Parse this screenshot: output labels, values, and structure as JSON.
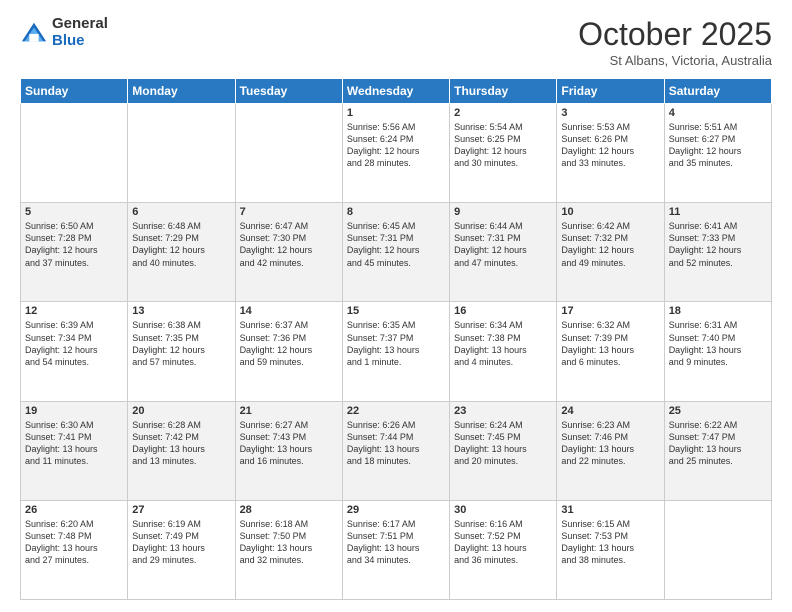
{
  "header": {
    "logo_general": "General",
    "logo_blue": "Blue",
    "month": "October 2025",
    "location": "St Albans, Victoria, Australia"
  },
  "weekdays": [
    "Sunday",
    "Monday",
    "Tuesday",
    "Wednesday",
    "Thursday",
    "Friday",
    "Saturday"
  ],
  "weeks": [
    [
      {
        "day": "",
        "info": ""
      },
      {
        "day": "",
        "info": ""
      },
      {
        "day": "",
        "info": ""
      },
      {
        "day": "1",
        "info": "Sunrise: 5:56 AM\nSunset: 6:24 PM\nDaylight: 12 hours\nand 28 minutes."
      },
      {
        "day": "2",
        "info": "Sunrise: 5:54 AM\nSunset: 6:25 PM\nDaylight: 12 hours\nand 30 minutes."
      },
      {
        "day": "3",
        "info": "Sunrise: 5:53 AM\nSunset: 6:26 PM\nDaylight: 12 hours\nand 33 minutes."
      },
      {
        "day": "4",
        "info": "Sunrise: 5:51 AM\nSunset: 6:27 PM\nDaylight: 12 hours\nand 35 minutes."
      }
    ],
    [
      {
        "day": "5",
        "info": "Sunrise: 6:50 AM\nSunset: 7:28 PM\nDaylight: 12 hours\nand 37 minutes."
      },
      {
        "day": "6",
        "info": "Sunrise: 6:48 AM\nSunset: 7:29 PM\nDaylight: 12 hours\nand 40 minutes."
      },
      {
        "day": "7",
        "info": "Sunrise: 6:47 AM\nSunset: 7:30 PM\nDaylight: 12 hours\nand 42 minutes."
      },
      {
        "day": "8",
        "info": "Sunrise: 6:45 AM\nSunset: 7:31 PM\nDaylight: 12 hours\nand 45 minutes."
      },
      {
        "day": "9",
        "info": "Sunrise: 6:44 AM\nSunset: 7:31 PM\nDaylight: 12 hours\nand 47 minutes."
      },
      {
        "day": "10",
        "info": "Sunrise: 6:42 AM\nSunset: 7:32 PM\nDaylight: 12 hours\nand 49 minutes."
      },
      {
        "day": "11",
        "info": "Sunrise: 6:41 AM\nSunset: 7:33 PM\nDaylight: 12 hours\nand 52 minutes."
      }
    ],
    [
      {
        "day": "12",
        "info": "Sunrise: 6:39 AM\nSunset: 7:34 PM\nDaylight: 12 hours\nand 54 minutes."
      },
      {
        "day": "13",
        "info": "Sunrise: 6:38 AM\nSunset: 7:35 PM\nDaylight: 12 hours\nand 57 minutes."
      },
      {
        "day": "14",
        "info": "Sunrise: 6:37 AM\nSunset: 7:36 PM\nDaylight: 12 hours\nand 59 minutes."
      },
      {
        "day": "15",
        "info": "Sunrise: 6:35 AM\nSunset: 7:37 PM\nDaylight: 13 hours\nand 1 minute."
      },
      {
        "day": "16",
        "info": "Sunrise: 6:34 AM\nSunset: 7:38 PM\nDaylight: 13 hours\nand 4 minutes."
      },
      {
        "day": "17",
        "info": "Sunrise: 6:32 AM\nSunset: 7:39 PM\nDaylight: 13 hours\nand 6 minutes."
      },
      {
        "day": "18",
        "info": "Sunrise: 6:31 AM\nSunset: 7:40 PM\nDaylight: 13 hours\nand 9 minutes."
      }
    ],
    [
      {
        "day": "19",
        "info": "Sunrise: 6:30 AM\nSunset: 7:41 PM\nDaylight: 13 hours\nand 11 minutes."
      },
      {
        "day": "20",
        "info": "Sunrise: 6:28 AM\nSunset: 7:42 PM\nDaylight: 13 hours\nand 13 minutes."
      },
      {
        "day": "21",
        "info": "Sunrise: 6:27 AM\nSunset: 7:43 PM\nDaylight: 13 hours\nand 16 minutes."
      },
      {
        "day": "22",
        "info": "Sunrise: 6:26 AM\nSunset: 7:44 PM\nDaylight: 13 hours\nand 18 minutes."
      },
      {
        "day": "23",
        "info": "Sunrise: 6:24 AM\nSunset: 7:45 PM\nDaylight: 13 hours\nand 20 minutes."
      },
      {
        "day": "24",
        "info": "Sunrise: 6:23 AM\nSunset: 7:46 PM\nDaylight: 13 hours\nand 22 minutes."
      },
      {
        "day": "25",
        "info": "Sunrise: 6:22 AM\nSunset: 7:47 PM\nDaylight: 13 hours\nand 25 minutes."
      }
    ],
    [
      {
        "day": "26",
        "info": "Sunrise: 6:20 AM\nSunset: 7:48 PM\nDaylight: 13 hours\nand 27 minutes."
      },
      {
        "day": "27",
        "info": "Sunrise: 6:19 AM\nSunset: 7:49 PM\nDaylight: 13 hours\nand 29 minutes."
      },
      {
        "day": "28",
        "info": "Sunrise: 6:18 AM\nSunset: 7:50 PM\nDaylight: 13 hours\nand 32 minutes."
      },
      {
        "day": "29",
        "info": "Sunrise: 6:17 AM\nSunset: 7:51 PM\nDaylight: 13 hours\nand 34 minutes."
      },
      {
        "day": "30",
        "info": "Sunrise: 6:16 AM\nSunset: 7:52 PM\nDaylight: 13 hours\nand 36 minutes."
      },
      {
        "day": "31",
        "info": "Sunrise: 6:15 AM\nSunset: 7:53 PM\nDaylight: 13 hours\nand 38 minutes."
      },
      {
        "day": "",
        "info": ""
      }
    ]
  ]
}
